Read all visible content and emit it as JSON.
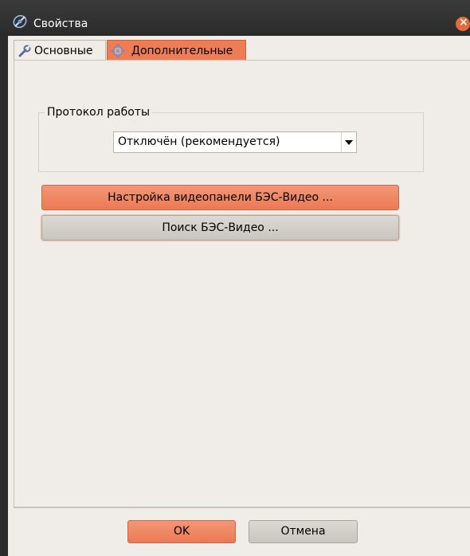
{
  "window": {
    "title": "Свойства",
    "close_icon": "close-icon"
  },
  "tabs": [
    {
      "label": "Основные",
      "icon": "wrench-icon",
      "selected": false
    },
    {
      "label": "Дополнительные",
      "icon": "gear-icon",
      "selected": true
    }
  ],
  "protocol": {
    "group_label": "Протокол работы",
    "selected_value": "Отключён (рекомендуется)"
  },
  "buttons": {
    "video_panel_settings": "Настройка видеопанели БЭС-Видео ...",
    "search_video": "Поиск БЭС-Видео ...",
    "ok": "OK",
    "cancel": "Отмена"
  },
  "colors": {
    "accent": "#ee7d55",
    "panel_bg": "#f0ede8",
    "titlebar": "#2b2b2b"
  }
}
